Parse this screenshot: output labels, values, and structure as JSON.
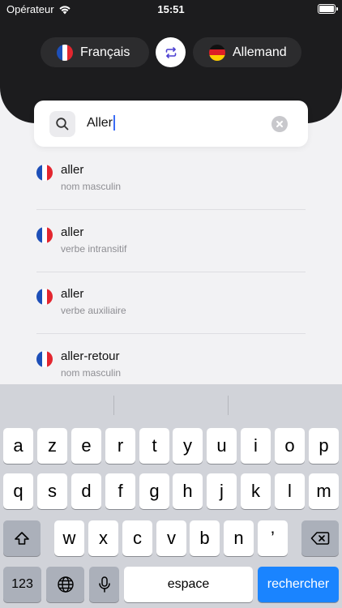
{
  "status_bar": {
    "carrier": "Opérateur",
    "time": "15:51"
  },
  "languages": {
    "source": {
      "label": "Français",
      "flag": "fr-flag-icon"
    },
    "target": {
      "label": "Allemand",
      "flag": "de-flag-icon"
    },
    "swap": "swap-icon"
  },
  "search": {
    "value": "Aller",
    "clear": "clear-icon"
  },
  "results": [
    {
      "word": "aller",
      "pos": "nom masculin"
    },
    {
      "word": "aller",
      "pos": "verbe intransitif"
    },
    {
      "word": "aller",
      "pos": "verbe auxiliaire"
    },
    {
      "word": "aller-retour",
      "pos": "nom masculin"
    }
  ],
  "keyboard": {
    "row1": [
      "a",
      "z",
      "e",
      "r",
      "t",
      "y",
      "u",
      "i",
      "o",
      "p"
    ],
    "row2": [
      "q",
      "s",
      "d",
      "f",
      "g",
      "h",
      "j",
      "k",
      "l",
      "m"
    ],
    "row3": [
      "w",
      "x",
      "c",
      "v",
      "b",
      "n",
      "’"
    ],
    "numbers_key": "123",
    "space_key": "espace",
    "return_key": "rechercher"
  },
  "colors": {
    "header": "#1c1c1e",
    "pill": "#2c2c2e",
    "accent": "#1a84ff",
    "swap_icon": "#4b3fd1"
  }
}
